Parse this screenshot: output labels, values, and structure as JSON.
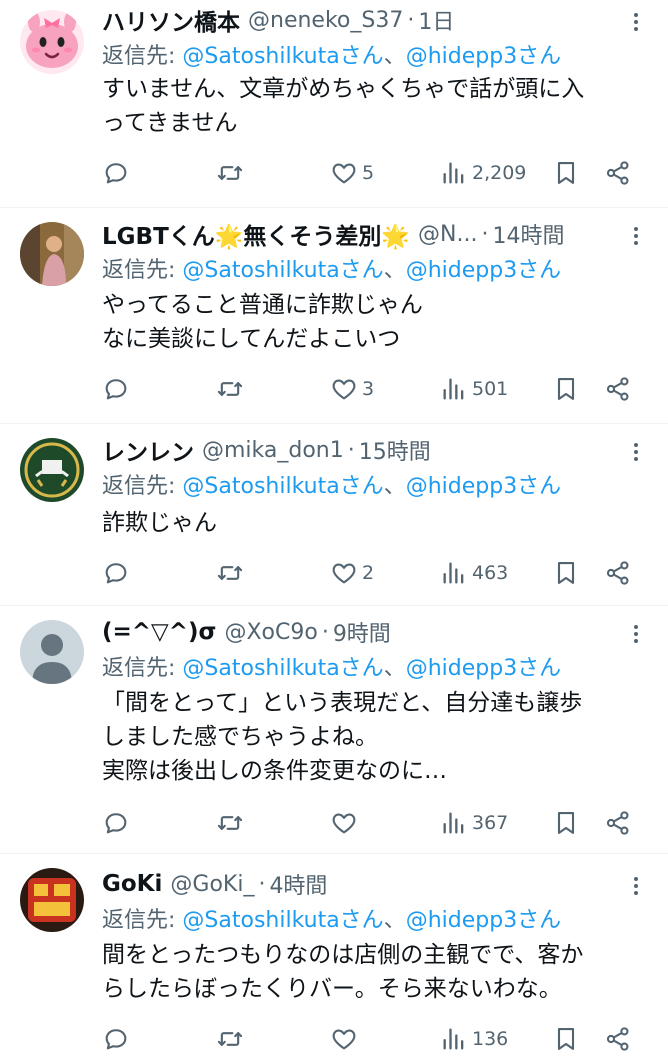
{
  "reply_prefix": "返信先: ",
  "reply_joiner": "、",
  "tweets": [
    {
      "name": "ハリソン橋本",
      "handle": "@neneko_S37",
      "separator": "·",
      "time": "1日",
      "mention1": "@Satoshilkutaさん",
      "mention2": "@hidepp3さん",
      "text": "すいません、文章がめちゃくちゃで話が頭に入\nってきません",
      "likes": "5",
      "views": "2,209"
    },
    {
      "name": "LGBTくん🌟無くそう差別🌟",
      "handle": "@N...",
      "separator": "·",
      "time": "14時間",
      "mention1": "@Satoshilkutaさん",
      "mention2": "@hidepp3さん",
      "text": "やってること普通に詐欺じゃん\nなに美談にしてんだよこいつ",
      "likes": "3",
      "views": "501"
    },
    {
      "name": "レンレン",
      "handle": "@mika_don1",
      "separator": "·",
      "time": "15時間",
      "mention1": "@Satoshilkutaさん",
      "mention2": "@hidepp3さん",
      "text": "詐欺じゃん",
      "likes": "2",
      "views": "463"
    },
    {
      "name": "(=^▽^)σ",
      "handle": "@XoC9o",
      "separator": "·",
      "time": "9時間",
      "mention1": "@Satoshilkutaさん",
      "mention2": "@hidepp3さん",
      "text": "「間をとって」という表現だと、自分達も譲歩\nしました感でちゃうよね。\n実際は後出しの条件変更なのに…",
      "likes": "",
      "views": "367"
    },
    {
      "name": "GoKi",
      "handle": "@GoKi_",
      "separator": "·",
      "time": "4時間",
      "mention1": "@Satoshilkutaさん",
      "mention2": "@hidepp3さん",
      "text": "間をとったつもりなのは店側の主観でで、客か\nらしたらぼったくりバー。そら来ないわな。",
      "likes": "",
      "views": "136"
    }
  ],
  "icons": {
    "avatar_0": "pink-bunny-avatar-icon",
    "avatar_1": "person-photo-avatar-icon",
    "avatar_2": "emblem-avatar-icon",
    "avatar_3": "default-person-avatar-icon",
    "avatar_4": "sign-photo-avatar-icon",
    "reply": "reply-icon",
    "retweet": "retweet-icon",
    "like": "heart-icon",
    "views": "views-icon",
    "bookmark": "bookmark-icon",
    "share": "share-icon",
    "more": "more-icon"
  },
  "colors": {
    "link": "#1d9bf0",
    "secondary_text": "#536471",
    "primary_text": "#0f1419",
    "divider": "#eff3f4"
  }
}
